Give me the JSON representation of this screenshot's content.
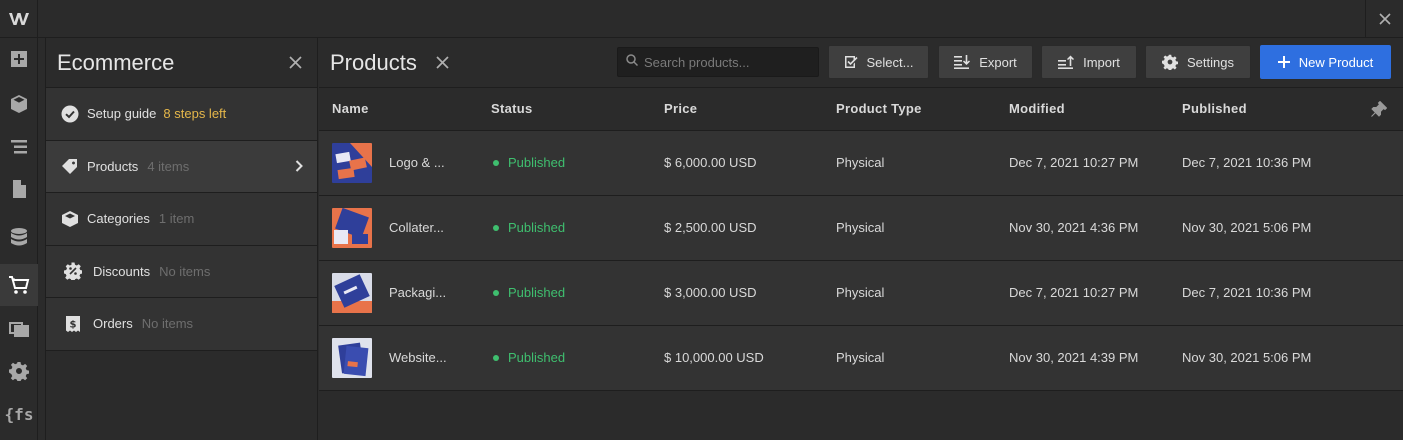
{
  "app": {
    "logo_letter": "W"
  },
  "rail": {
    "items": [
      {
        "icon": "add-icon"
      },
      {
        "icon": "cube-icon"
      },
      {
        "icon": "navigator-icon"
      },
      {
        "icon": "pages-icon"
      },
      {
        "icon": "cms-icon"
      },
      {
        "icon": "ecommerce-cart-icon",
        "active": true
      },
      {
        "icon": "assets-icon"
      },
      {
        "icon": "settings-icon"
      },
      {
        "icon": "finsweet-icon",
        "text": "{fs"
      }
    ]
  },
  "panel": {
    "title": "Ecommerce",
    "items": [
      {
        "label": "Setup guide",
        "meta": "8 steps left",
        "icon": "check-circle-icon"
      },
      {
        "label": "Products",
        "meta": "4 items",
        "icon": "tag-icon",
        "active": true
      },
      {
        "label": "Categories",
        "meta": "1 item",
        "icon": "category-icon"
      },
      {
        "label": "Discounts",
        "meta": "No items",
        "icon": "discount-icon"
      },
      {
        "label": "Orders",
        "meta": "No items",
        "icon": "order-icon"
      }
    ]
  },
  "main": {
    "title": "Products",
    "search_placeholder": "Search products...",
    "buttons": {
      "select": "Select...",
      "export": "Export",
      "import": "Import",
      "settings": "Settings",
      "new_product": "New Product"
    },
    "columns": [
      "Name",
      "Status",
      "Price",
      "Product Type",
      "Modified",
      "Published"
    ],
    "rows": [
      {
        "name": "Logo & ...",
        "status": "Published",
        "price": "$ 6,000.00 USD",
        "type": "Physical",
        "modified": "Dec 7, 2021 10:27 PM",
        "published": "Dec 7, 2021 10:36 PM"
      },
      {
        "name": "Collater...",
        "status": "Published",
        "price": "$ 2,500.00 USD",
        "type": "Physical",
        "modified": "Nov 30, 2021 4:36 PM",
        "published": "Nov 30, 2021 5:06 PM"
      },
      {
        "name": "Packagi...",
        "status": "Published",
        "price": "$ 3,000.00 USD",
        "type": "Physical",
        "modified": "Dec 7, 2021 10:27 PM",
        "published": "Dec 7, 2021 10:36 PM"
      },
      {
        "name": "Website...",
        "status": "Published",
        "price": "$ 10,000.00 USD",
        "type": "Physical",
        "modified": "Nov 30, 2021 4:39 PM",
        "published": "Nov 30, 2021 5:06 PM"
      }
    ]
  },
  "colors": {
    "accent": "#2e6fe0",
    "published": "#3fbf6f",
    "warning": "#e5b74a"
  }
}
